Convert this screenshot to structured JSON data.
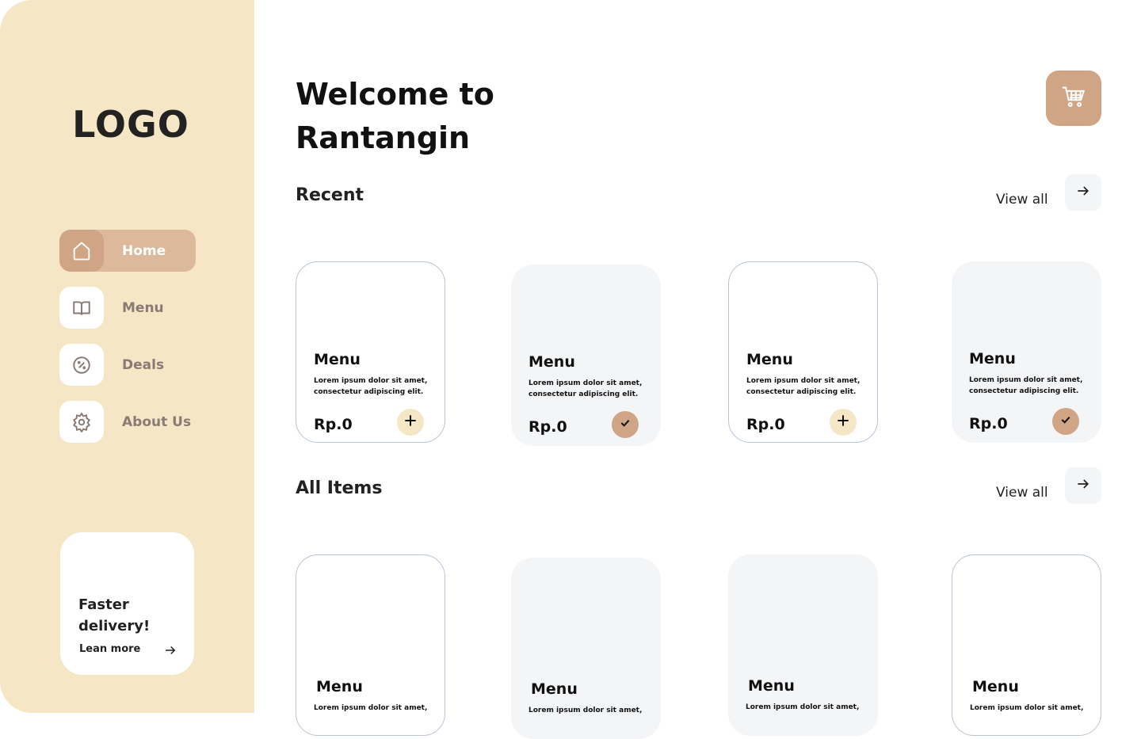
{
  "sidebar": {
    "logo": "LOGO",
    "items": [
      {
        "label": "Home",
        "icon": "home-icon",
        "active": true
      },
      {
        "label": "Menu",
        "icon": "book-icon",
        "active": false
      },
      {
        "label": "Deals",
        "icon": "discount-icon",
        "active": false
      },
      {
        "label": "About Us",
        "icon": "gear-icon",
        "active": false
      }
    ],
    "promo": {
      "title": "Faster delivery!",
      "link": "Lean more"
    }
  },
  "header": {
    "title": "Welcome to Rantangin"
  },
  "recent": {
    "title": "Recent",
    "view_all": "View all",
    "items": [
      {
        "name": "Menu",
        "desc": "Lorem ipsum dolor sit amet, consectetur adipiscing elit.",
        "price": "Rp.0",
        "state": "add",
        "style": "outline"
      },
      {
        "name": "Menu",
        "desc": "Lorem ipsum dolor sit amet, consectetur adipiscing elit.",
        "price": "Rp.0",
        "state": "added",
        "style": "filled"
      },
      {
        "name": "Menu",
        "desc": "Lorem ipsum dolor sit amet, consectetur adipiscing elit.",
        "price": "Rp.0",
        "state": "add",
        "style": "outline"
      },
      {
        "name": "Menu",
        "desc": "Lorem ipsum dolor sit amet, consectetur adipiscing elit.",
        "price": "Rp.0",
        "state": "added",
        "style": "filled"
      }
    ]
  },
  "all_items": {
    "title": "All Items",
    "view_all": "View all",
    "items": [
      {
        "name": "Menu",
        "desc": "Lorem ipsum dolor sit amet,",
        "style": "outline"
      },
      {
        "name": "Menu",
        "desc": "Lorem ipsum dolor sit amet,",
        "style": "filled"
      },
      {
        "name": "Menu",
        "desc": "Lorem ipsum dolor sit amet,",
        "style": "filled"
      },
      {
        "name": "Menu",
        "desc": "Lorem ipsum dolor sit amet,",
        "style": "outline"
      }
    ]
  },
  "colors": {
    "sidebar": "#f5e7c6",
    "accent": "#cfa586",
    "card": "#f4f5f7"
  }
}
